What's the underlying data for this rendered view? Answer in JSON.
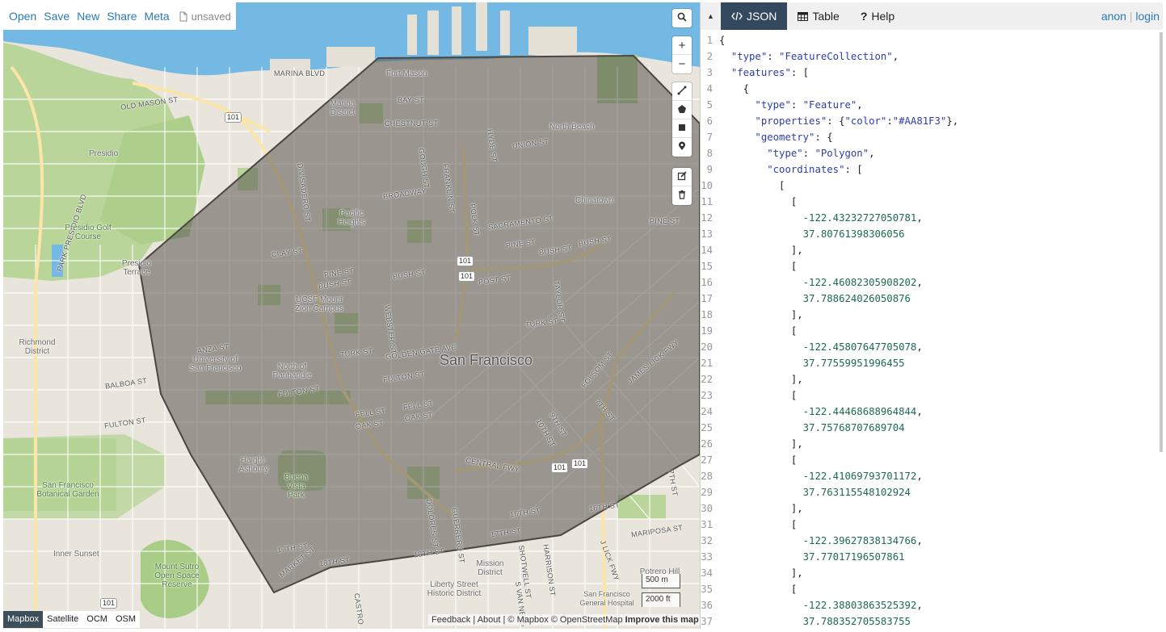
{
  "menu": {
    "items": [
      "Open",
      "Save",
      "New",
      "Share",
      "Meta"
    ],
    "unsaved": "unsaved"
  },
  "map": {
    "polygon_color": "#AA81F3",
    "labels": {
      "marina_blvd": "MARINA BLVD",
      "fort_mason": "Fort Mason",
      "old_mason_st": "OLD MASON ST",
      "hwy_101_a": "101",
      "marina_district": "Marina District",
      "bay_st": "BAY ST",
      "chestnut_st": "CHESTNUT ST",
      "north_beach": "North Beach",
      "presidio": "Presidio",
      "union_st": "UNION ST",
      "divisadero_st": "DIVISADERO ST",
      "gough_st": "GOUGH ST",
      "franklin_st": "FRANKLIN ST",
      "hyde_st": "HYDE ST",
      "broadway": "BROADWAY",
      "chinatown": "Chinatown",
      "park_presidio_blvd": "PARK PRESIDIO BLVD",
      "presidio_golf": "Presidio Golf Course",
      "pacific_heights": "Pacific Heights",
      "polk_st": "POLK ST",
      "sacramento_st": "SACRAMENTO ST",
      "pine_st_a": "PINE ST",
      "bush_st_a": "BUSH ST",
      "pine_st_b": "PINE ST",
      "presidio_terrace": "Presidio Terrace",
      "clay_st": "CLAY ST",
      "pine_st_c": "PINE ST",
      "bush_st_b": "BUSH ST",
      "bush_st_c": "BUSH ST",
      "bush_st_d": "BUSH ST",
      "post_st": "POST ST",
      "hwy_101_b": "101",
      "hwy_101_c": "101",
      "ucsf": "UCSF Mount Zion Campus",
      "taylor_st": "TAYLOR ST",
      "turk_st_a": "TURK ST",
      "richmond": "Richmond District",
      "anza_st": "ANZA ST",
      "usf": "University of San Francisco",
      "turk_st_b": "TURK ST",
      "golden_gate_ave": "GOLDEN GATE AVE",
      "san_francisco": "San Francisco",
      "webster_st": "WEBSTER ST",
      "north_panhandle": "North of Panhandle",
      "fulton_st_a": "FULTON ST",
      "balboa_st": "BALBOA ST",
      "fulton_st_b": "FULTON ST",
      "fulton_st_c": "FULTON ST",
      "fell_st_a": "FELL ST",
      "oak_st_a": "OAK ST",
      "fell_st_b": "FELL ST",
      "oak_st_b": "OAK ST",
      "folsom_st": "FOLSOM ST",
      "james_lick_fwy": "JAMES LICK FWY",
      "seventh_st_a": "7TH ST",
      "ninth_st": "9TH ST",
      "tenth_st": "10TH ST",
      "haight": "Haight-Ashbury",
      "central_fwy": "CENTRAL FWY",
      "hwy_101_d": "101",
      "hwy_101_e": "101",
      "buena_vista": "Buena Vista Park",
      "sf_botanical": "San Francisco Botanical Garden",
      "seventh_st_b": "7TH ST",
      "sixteenth_st_a": "16TH ST",
      "dolores_st": "DOLORES ST",
      "guerrero_st": "GUERRERO ST",
      "sixteenth_st_b": "16TH ST",
      "seventeenth_st_a": "17TH ST",
      "mariposa_st": "MARIPOSA ST",
      "inner_sunset": "Inner Sunset",
      "seventeenth_st_b": "17TH ST",
      "market_st": "MARKET ST",
      "eighteenth_st_a": "18TH ST",
      "eighteenth_st_b": "18TH ST",
      "mission": "Mission District",
      "shotwell_st": "SHOTWELL ST",
      "harrison_st": "HARRISON ST",
      "potrero": "Potrero Hill",
      "mount_sutro": "Mount Sutro Open Space Reserve",
      "liberty": "Liberty Street Historic District",
      "van_ness": "S VAN NESS",
      "sf_general": "San Francisco General Hospital",
      "castro": "CASTRO",
      "hwy_101_f": "101",
      "lick_fwy_2": "J LICK FWY"
    },
    "layers": [
      "Mapbox",
      "Satellite",
      "OCM",
      "OSM"
    ],
    "active_layer": "Mapbox",
    "scale_metric": "500 m",
    "scale_imperial": "2000 ft",
    "attribution": {
      "feedback": "Feedback",
      "about": "About",
      "copyright": "© Mapbox © OpenStreetMap",
      "improve": "Improve this map"
    },
    "icons": [
      "search-icon",
      "zoom-in-icon",
      "zoom-out-icon",
      "draw-line-icon",
      "draw-polygon-icon",
      "draw-rectangle-icon",
      "draw-marker-icon",
      "edit-icon",
      "trash-icon"
    ]
  },
  "panel": {
    "tabs": [
      {
        "label": "JSON",
        "icon": "code-icon"
      },
      {
        "label": "Table",
        "icon": "table-icon"
      },
      {
        "label": "Help",
        "icon": "help-icon"
      }
    ],
    "active_tab": "JSON",
    "auth": {
      "anon": "anon",
      "separator": "|",
      "login": "login"
    },
    "code_lines": [
      "{",
      "  \"type\": \"FeatureCollection\",",
      "  \"features\": [",
      "    {",
      "      \"type\": \"Feature\",",
      "      \"properties\": {\"color\":\"#AA81F3\"},",
      "      \"geometry\": {",
      "        \"type\": \"Polygon\",",
      "        \"coordinates\": [",
      "          [",
      "            [",
      "              -122.43232727050781,",
      "              37.80761398306056",
      "            ],",
      "            [",
      "              -122.46082305908202,",
      "              37.788624026050876",
      "            ],",
      "            [",
      "              -122.45807647705078,",
      "              37.77559951996455",
      "            ],",
      "            [",
      "              -122.44468688964844,",
      "              37.75768707689704",
      "            ],",
      "            [",
      "              -122.41069793701172,",
      "              37.763115548102924",
      "            ],",
      "            [",
      "              -122.39627838134766,",
      "              37.77017196507861",
      "            ],",
      "            [",
      "              -122.38803863525392,",
      "              37.788352705583755"
    ]
  }
}
